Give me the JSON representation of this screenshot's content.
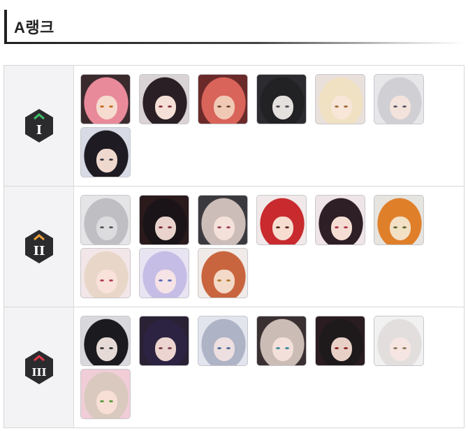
{
  "heading": {
    "title": "A랭크"
  },
  "tiers": [
    {
      "tier_icon": "tier-1-hexagon-icon",
      "numeral": "I",
      "portraits": [
        {
          "bg": "#3a2a2e",
          "hair": "#e98a9a",
          "skin": "#f6dccf",
          "eye": "#c76a1c"
        },
        {
          "bg": "#d9d3d5",
          "hair": "#2a1f24",
          "skin": "#f5e0d7",
          "eye": "#8a2f3a"
        },
        {
          "bg": "#6a2a2a",
          "hair": "#d9645a",
          "skin": "#f0c9b5",
          "eye": "#6b4c2d"
        },
        {
          "bg": "#2c2c30",
          "hair": "#222225",
          "skin": "#e4e0dd",
          "eye": "#4a4a55"
        },
        {
          "bg": "#e9e0dc",
          "hair": "#f0e1c3",
          "skin": "#f8e6d8",
          "eye": "#9c6b3a"
        },
        {
          "bg": "#e7e7ea",
          "hair": "#cfcfd4",
          "skin": "#f4e3dc",
          "eye": "#5a5a66"
        },
        {
          "bg": "#d8dbe6",
          "hair": "#1e1c22",
          "skin": "#efd9cf",
          "eye": "#3a3a44"
        }
      ]
    },
    {
      "tier_icon": "tier-2-hexagon-icon",
      "numeral": "II",
      "portraits": [
        {
          "bg": "#e5e5e7",
          "hair": "#bfbfc3",
          "skin": "#dcdcdf",
          "eye": "#555"
        },
        {
          "bg": "#2a1a1c",
          "hair": "#1a1418",
          "skin": "#e9d3cc",
          "eye": "#7a2a3a"
        },
        {
          "bg": "#3a3a3e",
          "hair": "#cdbdb8",
          "skin": "#f3e1da",
          "eye": "#a0405a"
        },
        {
          "bg": "#f1e9e9",
          "hair": "#c82a2e",
          "skin": "#f7dcd0",
          "eye": "#5a2a1a"
        },
        {
          "bg": "#efe4e8",
          "hair": "#2e1e26",
          "skin": "#f6ddd3",
          "eye": "#b0304a"
        },
        {
          "bg": "#e6e4df",
          "hair": "#e07f2a",
          "skin": "#f2e0c7",
          "eye": "#5a6a2a"
        },
        {
          "bg": "#f3e6e8",
          "hair": "#e8d6c8",
          "skin": "#f8e2da",
          "eye": "#b0405a"
        },
        {
          "bg": "#e8e4f2",
          "hair": "#c6bde6",
          "skin": "#f5e3e6",
          "eye": "#5a6ab8"
        },
        {
          "bg": "#f0ebe8",
          "hair": "#c9653e",
          "skin": "#f3d9c8",
          "eye": "#b07a2a"
        }
      ]
    },
    {
      "tier_icon": "tier-3-hexagon-icon",
      "numeral": "III",
      "portraits": [
        {
          "bg": "#d9d9dd",
          "hair": "#1b1b1f",
          "skin": "#e6dad6",
          "eye": "#333"
        },
        {
          "bg": "#2a2234",
          "hair": "#2c2242",
          "skin": "#ecd4d0",
          "eye": "#7a3a4a"
        },
        {
          "bg": "#e2e5ee",
          "hair": "#aeb3c6",
          "skin": "#eedfe0",
          "eye": "#4a6a9a"
        },
        {
          "bg": "#3a3032",
          "hair": "#cbbcb6",
          "skin": "#f3e0da",
          "eye": "#3a8a9a"
        },
        {
          "bg": "#2a1c20",
          "hair": "#1e1a1c",
          "skin": "#e8d0c6",
          "eye": "#8a2020"
        },
        {
          "bg": "#f1f1f2",
          "hair": "#e2dede",
          "skin": "#f6e6e2",
          "eye": "#8a7a5a"
        },
        {
          "bg": "#f0cdd7",
          "hair": "#d9c9be",
          "skin": "#f7dfd6",
          "eye": "#5a9a3a"
        }
      ]
    }
  ]
}
